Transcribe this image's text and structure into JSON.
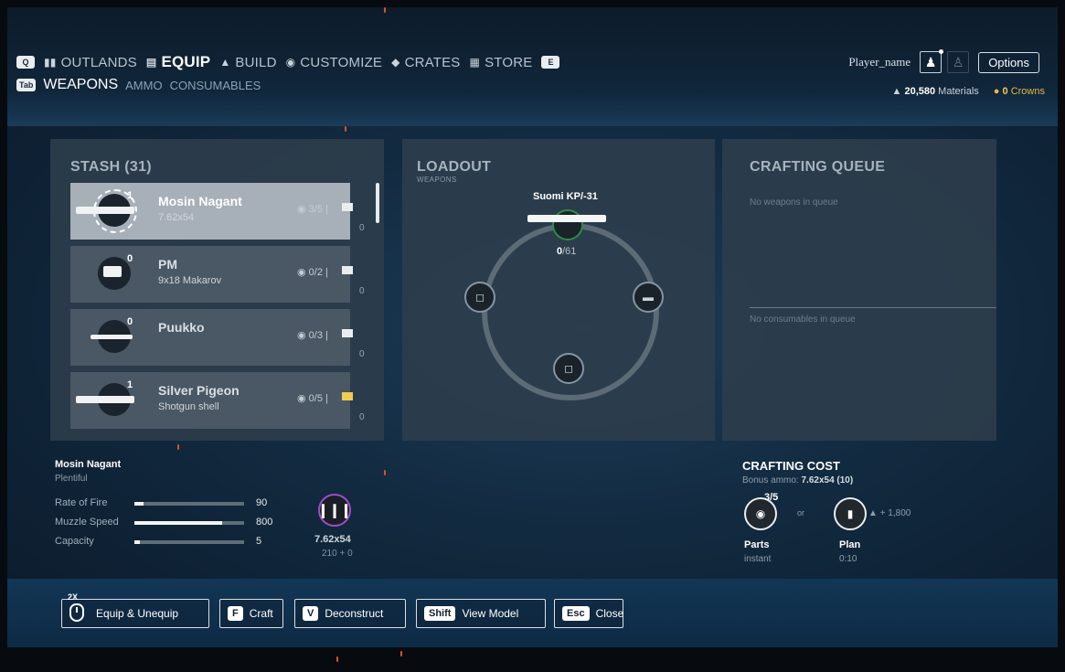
{
  "nav": {
    "left_key": "Q",
    "right_key": "E",
    "items": [
      {
        "label": "OUTLANDS",
        "icon": "bars-icon"
      },
      {
        "label": "EQUIP",
        "icon": "chest-icon",
        "active": true
      },
      {
        "label": "BUILD",
        "icon": "house-icon"
      },
      {
        "label": "CUSTOMIZE",
        "icon": "helmet-icon"
      },
      {
        "label": "CRATES",
        "icon": "crate-icon"
      },
      {
        "label": "STORE",
        "icon": "store-icon"
      }
    ]
  },
  "subnav": {
    "key": "Tab",
    "items": [
      "WEAPONS",
      "AMMO",
      "CONSUMABLES"
    ]
  },
  "profile": {
    "player_name": "Player_name",
    "options_label": "Options"
  },
  "currency": {
    "materials_value": "20,580",
    "materials_label": "Materials",
    "crowns_value": "0",
    "crowns_label": "Crowns"
  },
  "stash": {
    "title": "STASH (31)",
    "items": [
      {
        "count": "1",
        "name": "Mosin Nagant",
        "ammo": "7.62x54",
        "parts": "3/5",
        "plan_count": "0"
      },
      {
        "count": "0",
        "name": "PM",
        "ammo": "9x18 Makarov",
        "parts": "0/2",
        "plan_count": "0"
      },
      {
        "count": "0",
        "name": "Puukko",
        "ammo": "",
        "parts": "0/3",
        "plan_count": "0"
      },
      {
        "count": "1",
        "name": "Silver Pigeon",
        "ammo": "Shotgun shell",
        "parts": "0/5",
        "plan_count": "0"
      }
    ]
  },
  "loadout": {
    "title": "LOADOUT",
    "subtitle": "WEAPONS",
    "top_slot_name": "Suomi KP/-31",
    "ammo_loaded": "0",
    "ammo_reserve": "/61"
  },
  "queue": {
    "title": "CRAFTING QUEUE",
    "weapons_empty": "No weapons in queue",
    "consumables_empty": "No consumables in queue"
  },
  "selected_weapon": {
    "name": "Mosin Nagant",
    "availability": "Plentiful",
    "stats": [
      {
        "label": "Rate of Fire",
        "value": "90",
        "fill": 0.08
      },
      {
        "label": "Muzzle Speed",
        "value": "800",
        "fill": 0.8
      },
      {
        "label": "Capacity",
        "value": "5",
        "fill": 0.05
      }
    ],
    "ammo_type": "7.62x54",
    "ammo_total": "210 + 0"
  },
  "crafting_cost": {
    "title": "CRAFTING COST",
    "bonus_prefix": "Bonus ammo:",
    "bonus_value": "7.62x54 (10)",
    "parts_fraction": "3/5",
    "or_label": "or",
    "materials_cost": "+ 1,800",
    "parts_label": "Parts",
    "parts_time": "instant",
    "plan_label": "Plan",
    "plan_time": "0:10"
  },
  "actions": [
    {
      "key": "",
      "label": "Equip & Unequip"
    },
    {
      "key": "F",
      "label": "Craft"
    },
    {
      "key": "V",
      "label": "Deconstruct"
    },
    {
      "key": "Shift",
      "label": "View Model"
    },
    {
      "key": "Esc",
      "label": "Close"
    }
  ],
  "mouse_key_label": "2X"
}
